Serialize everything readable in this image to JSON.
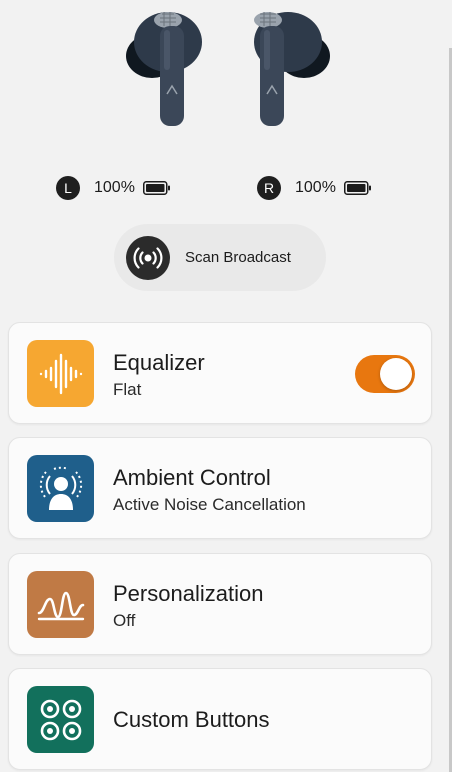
{
  "battery": {
    "left": {
      "side": "L",
      "percent": "100%",
      "level": 1.0
    },
    "right": {
      "side": "R",
      "percent": "100%",
      "level": 1.0
    }
  },
  "scan": {
    "label": "Scan Broadcast",
    "icon": "broadcast-icon"
  },
  "cards": {
    "equalizer": {
      "title": "Equalizer",
      "subtitle": "Flat",
      "toggle_on": true,
      "icon": "waveform-icon",
      "color": "#f6a731"
    },
    "ambient": {
      "title": "Ambient Control",
      "subtitle": "Active Noise Cancellation",
      "icon": "person-sound-icon",
      "color": "#1f5f8b"
    },
    "personalization": {
      "title": "Personalization",
      "subtitle": "Off",
      "icon": "wave-curve-icon",
      "color": "#c07a45"
    },
    "custom": {
      "title": "Custom Buttons",
      "icon": "button-grid-icon",
      "color": "#12705c"
    }
  },
  "colors": {
    "accent": "#e8770f",
    "background": "#f2f2f2"
  }
}
